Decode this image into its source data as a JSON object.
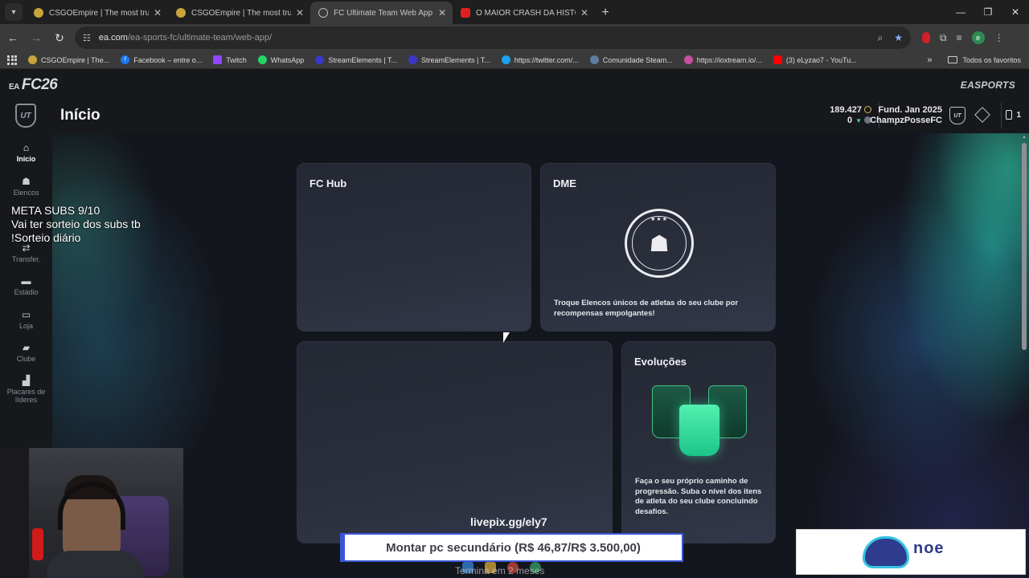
{
  "browser": {
    "tabs": [
      {
        "title": "CSGOEmpire | The most trusted",
        "favicon_color": "#c9a43a",
        "active": false
      },
      {
        "title": "CSGOEmpire | The most trusted",
        "favicon_color": "#c9a43a",
        "active": false
      },
      {
        "title": "FC Ultimate Team Web App - EA",
        "favicon_color": "#5a5a5a",
        "active": true
      },
      {
        "title": "O MAIOR CRASH DA HISTÓRIA",
        "favicon_color": "#e02020",
        "active": false
      }
    ],
    "address": {
      "host": "ea.com",
      "path": "/ea-sports-fc/ultimate-team/web-app/"
    },
    "bookmarks": [
      {
        "label": "CSGOEmpire | The...",
        "color": "#c9a43a"
      },
      {
        "label": "Facebook – entre o...",
        "color": "#1877f2"
      },
      {
        "label": "Twitch",
        "color": "#9146ff"
      },
      {
        "label": "WhatsApp",
        "color": "#25d366"
      },
      {
        "label": "StreamElements | T...",
        "color": "#3a37c9"
      },
      {
        "label": "StreamElements | T...",
        "color": "#3a37c9"
      },
      {
        "label": "https://twitter.com/...",
        "color": "#1da1f2"
      },
      {
        "label": "Comunidade Steam...",
        "color": "#1b2838"
      },
      {
        "label": "https://ioxtream.io/...",
        "color": "#c84fa0"
      },
      {
        "label": "(3) eLyzao7 - YouTu...",
        "color": "#ff0000"
      }
    ],
    "bookmarks_folder": "Todos os favoritos",
    "profile_initial": "e"
  },
  "app": {
    "logo": "FC26",
    "logo_prefix": "EA",
    "publisher": "EASPORTS",
    "ut_badge": "UT",
    "page_title": "Início",
    "coins": "189.427",
    "points": "0",
    "club_founded": "Fund. Jan 2025",
    "club_name": "ChampzPosseFC",
    "inbox_count": "1"
  },
  "sidebar": {
    "items": [
      {
        "label": "Início",
        "icon": "home-icon",
        "glyph": "⌂",
        "active": true
      },
      {
        "label": "Elencos",
        "icon": "squads-icon",
        "glyph": "☗",
        "active": false
      },
      {
        "label": "Transfer.",
        "icon": "transfer-icon",
        "glyph": "⇄",
        "active": false
      },
      {
        "label": "Estádio",
        "icon": "stadium-icon",
        "glyph": "▬",
        "active": false
      },
      {
        "label": "Loja",
        "icon": "store-icon",
        "glyph": "▭",
        "active": false
      },
      {
        "label": "Clube",
        "icon": "club-icon",
        "glyph": "▰",
        "active": false
      },
      {
        "label": "Placares de",
        "label2": "líderes",
        "icon": "leaderboards-icon",
        "glyph": "▟",
        "active": false
      }
    ]
  },
  "cards": {
    "fc_hub": {
      "title": "FC Hub"
    },
    "dme": {
      "title": "DME",
      "description_line1": "Troque Elencos únicos de atletas do seu clube por",
      "description_line2": "recompensas empolgantes!",
      "emblem_stars": "★★★"
    },
    "evolutions": {
      "title": "Evoluções",
      "line1": "Faça o seu próprio caminho de",
      "line2": "progressão. Suba o nível dos itens",
      "line3": "de atleta do seu clube concluindo",
      "line4": "desafios."
    }
  },
  "stream_overlay": {
    "meta_line1": "META SUBS 9/10",
    "meta_line2": "Vai ter sorteio dos subs tb",
    "meta_line3": "!Sorteio diário",
    "livepix": "livepix.gg/ely7",
    "goal": "Montar pc secundário (R$ 46,87/R$ 3.500,00)",
    "goal_sub": "Termina em 2 meses",
    "sponsor": "noe"
  },
  "colors": {
    "accent": "#3a56d8",
    "teal_glow": "#28d2c8",
    "evo_green": "#53f0b0"
  }
}
